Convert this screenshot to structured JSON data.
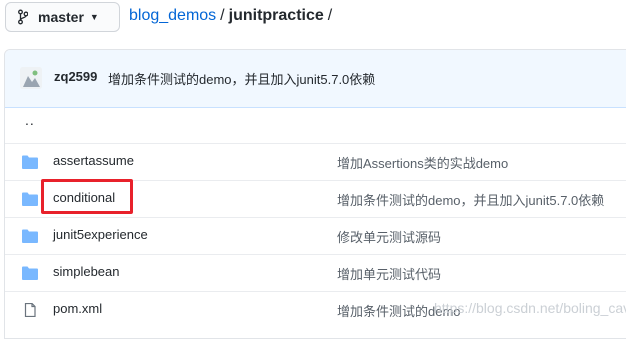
{
  "topbar": {
    "branch": "master",
    "breadcrumb": {
      "repo": "blog_demos",
      "separator": "/",
      "folder": "junitpractice",
      "trailing": "/"
    }
  },
  "commit": {
    "author": "zq2599",
    "message": "增加条件测试的demo，并且加入junit5.7.0依赖"
  },
  "parent_link": "..",
  "files": [
    {
      "type": "folder",
      "name": "assertassume",
      "message": "增加Assertions类的实战demo"
    },
    {
      "type": "folder",
      "name": "conditional",
      "message": "增加条件测试的demo，并且加入junit5.7.0依赖"
    },
    {
      "type": "folder",
      "name": "junit5experience",
      "message": "修改单元测试源码"
    },
    {
      "type": "folder",
      "name": "simplebean",
      "message": "增加单元测试代码"
    },
    {
      "type": "file",
      "name": "pom.xml",
      "message": "增加条件测试的demo"
    }
  ],
  "watermark": "https://blog.csdn.net/boling_cavalry",
  "colors": {
    "folder_icon": "#79b8ff",
    "link": "#0366d6",
    "highlight_border": "#e8212b",
    "commit_bar_bg": "#f1f8ff"
  },
  "highlighted_item": "conditional"
}
